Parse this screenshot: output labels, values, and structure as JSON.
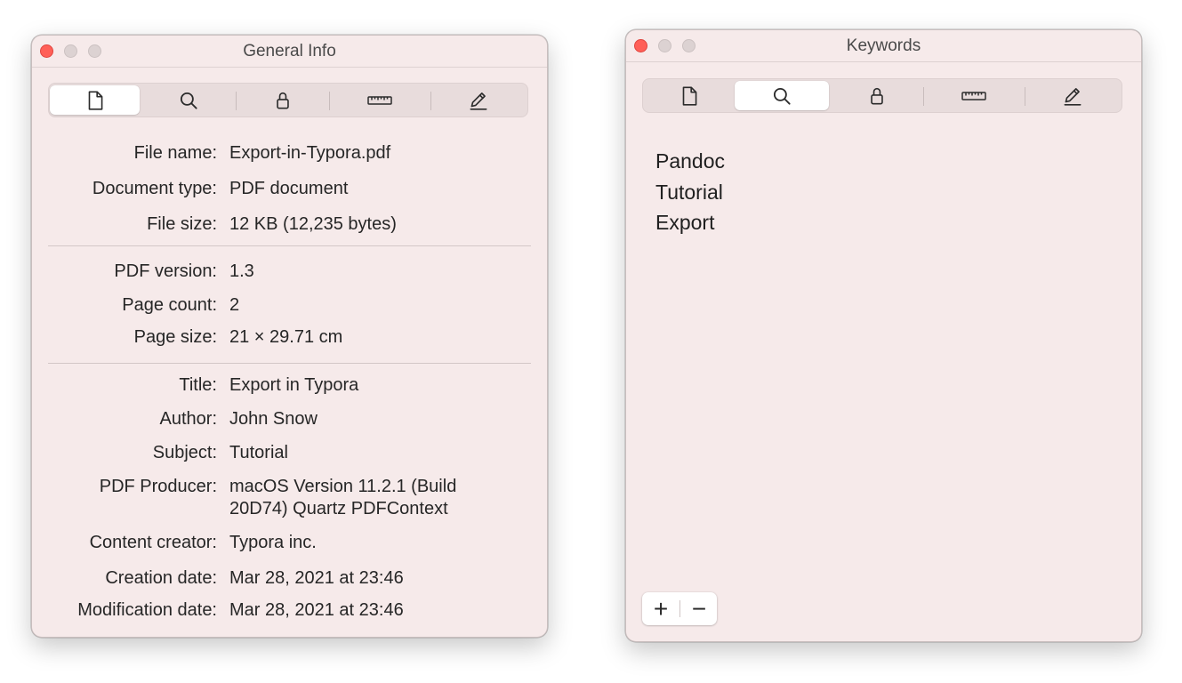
{
  "general_info": {
    "title": "General Info",
    "tabs": [
      {
        "name": "general",
        "icon": "document-icon",
        "active": true
      },
      {
        "name": "keywords",
        "icon": "search-icon",
        "active": false
      },
      {
        "name": "security",
        "icon": "lock-icon",
        "active": false
      },
      {
        "name": "cropping",
        "icon": "ruler-icon",
        "active": false
      },
      {
        "name": "annotations",
        "icon": "pen-icon",
        "active": false
      }
    ],
    "fields": {
      "file_name": {
        "label": "File name:",
        "value": "Export-in-Typora.pdf"
      },
      "document_type": {
        "label": "Document type:",
        "value": "PDF document"
      },
      "file_size": {
        "label": "File size:",
        "value": "12 KB (12,235 bytes)"
      },
      "pdf_version": {
        "label": "PDF version:",
        "value": "1.3"
      },
      "page_count": {
        "label": "Page count:",
        "value": "2"
      },
      "page_size": {
        "label": "Page size:",
        "value": "21 × 29.71 cm"
      },
      "title": {
        "label": "Title:",
        "value": "Export in Typora"
      },
      "author": {
        "label": "Author:",
        "value": "John Snow"
      },
      "subject": {
        "label": "Subject:",
        "value": "Tutorial"
      },
      "pdf_producer": {
        "label": "PDF Producer:",
        "value": "macOS Version 11.2.1 (Build 20D74) Quartz PDFContext"
      },
      "content_creator": {
        "label": "Content creator:",
        "value": "Typora inc."
      },
      "creation_date": {
        "label": "Creation date:",
        "value": "Mar 28, 2021 at 23:46"
      },
      "modification_date": {
        "label": "Modification date:",
        "value": "Mar 28, 2021 at 23:46"
      }
    }
  },
  "keywords_panel": {
    "title": "Keywords",
    "active_tab": "keywords",
    "keywords": [
      "Pandoc",
      "Tutorial",
      "Export"
    ],
    "add_label": "+",
    "remove_label": "−"
  },
  "colors": {
    "window_bg": "#f6eaea",
    "close_button": "#ff5f57",
    "inactive_traffic": "#dcd2d2",
    "segment_active": "#ffffff"
  }
}
